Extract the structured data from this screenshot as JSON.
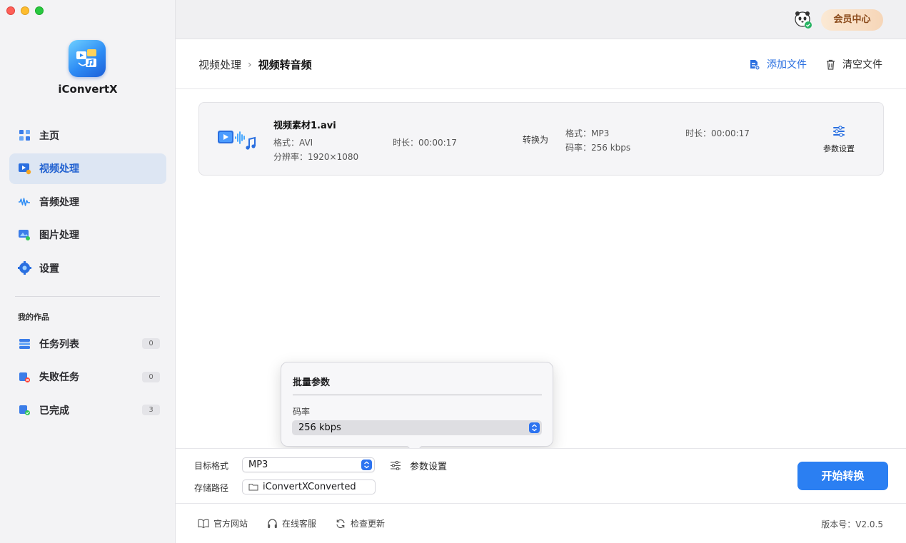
{
  "app": {
    "name": "iConvertX"
  },
  "sidebar": {
    "items": [
      {
        "label": "主页",
        "icon": "home-icon"
      },
      {
        "label": "视频处理",
        "icon": "video-process-icon",
        "active": true
      },
      {
        "label": "音频处理",
        "icon": "audio-wave-icon"
      },
      {
        "label": "图片处理",
        "icon": "image-process-icon"
      },
      {
        "label": "设置",
        "icon": "gear-icon"
      }
    ],
    "section_title": "我的作品",
    "works": [
      {
        "label": "任务列表",
        "count": "0",
        "icon": "task-list-icon"
      },
      {
        "label": "失败任务",
        "count": "0",
        "icon": "failed-task-icon"
      },
      {
        "label": "已完成",
        "count": "3",
        "icon": "completed-icon"
      }
    ]
  },
  "topbar": {
    "vip_label": "会员中心"
  },
  "header": {
    "breadcrumb_parent": "视频处理",
    "breadcrumb_sep": "›",
    "breadcrumb_current": "视频转音频",
    "add_file": "添加文件",
    "clear_files": "清空文件"
  },
  "file": {
    "name": "视频素材1.avi",
    "format": "格式：AVI",
    "resolution": "分辨率：1920×1080",
    "duration": "时长：00:00:17",
    "convert_to": "转换为",
    "out_format": "格式：MP3",
    "out_bitrate": "码率：256 kbps",
    "out_duration": "时长：00:00:17",
    "params_label": "参数设置"
  },
  "popover": {
    "title": "批量参数",
    "bitrate_label": "码率",
    "bitrate_value": "256 kbps"
  },
  "config": {
    "target_format_label": "目标格式",
    "target_format_value": "MP3",
    "params_label": "参数设置",
    "save_path_label": "存储路径",
    "save_path_value": "iConvertXConverted",
    "start_label": "开始转换"
  },
  "footer": {
    "website": "官方网站",
    "support": "在线客服",
    "update": "检查更新",
    "version": "版本号：V2.0.5"
  },
  "colors": {
    "accent": "#2b7ff2",
    "active_bg": "#dde6f3",
    "vip_text": "#8a4a1a"
  }
}
